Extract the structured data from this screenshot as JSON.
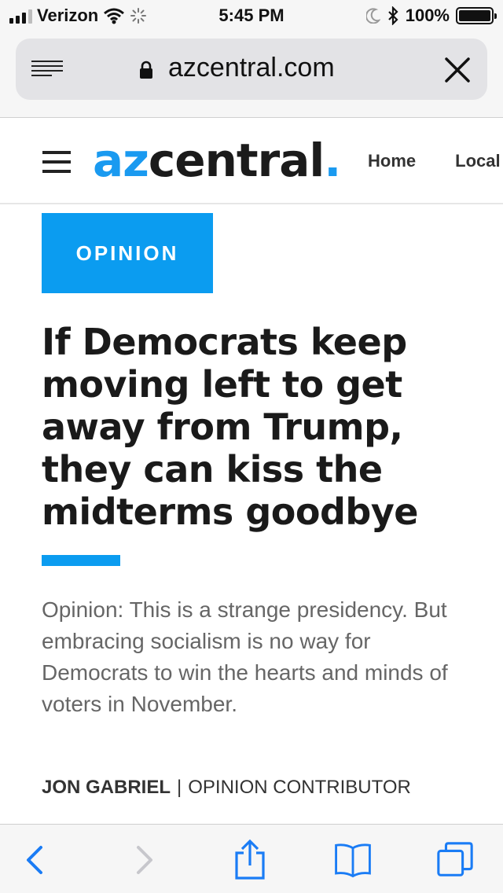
{
  "status_bar": {
    "carrier": "Verizon",
    "time": "5:45 PM",
    "battery": "100%",
    "icons": [
      "signal-icon",
      "wifi-icon",
      "activity-spinner-icon",
      "moon-icon",
      "bluetooth-icon",
      "battery-icon"
    ]
  },
  "browser": {
    "url": "azcentral.com",
    "load_progress": 0.36,
    "icons": [
      "reader-icon",
      "lock-icon",
      "close-icon"
    ]
  },
  "site": {
    "logo_az": "az",
    "logo_central": "central",
    "logo_dot": ".",
    "nav": [
      "Home",
      "Local"
    ],
    "accent_color": "#0b9cf0"
  },
  "article": {
    "section": "OPINION",
    "headline": "If Democrats keep moving left to get away from Trump, they can kiss the midterms goodbye",
    "summary": "Opinion: This is a strange presidency. But embracing socialism is no way for Democrats to win the hearts and minds of voters in November.",
    "author": "JON GABRIEL",
    "separator": "|",
    "author_role": "OPINION CONTRIBUTOR"
  },
  "toolbar": {
    "icons": [
      "back-icon",
      "forward-icon",
      "share-icon",
      "bookmarks-icon",
      "tabs-icon"
    ]
  }
}
